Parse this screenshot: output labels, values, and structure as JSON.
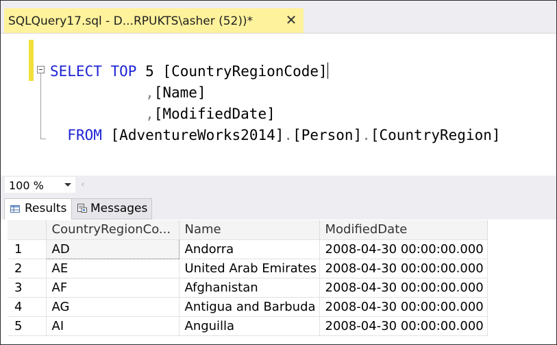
{
  "tab": {
    "title": "SQLQuery17.sql - D...RPUKTS\\asher (52))*",
    "close_glyph": "✕"
  },
  "editor": {
    "line1": {
      "kw1": "SELECT",
      "kw2": "TOP",
      "num": "5",
      "col": "[CountryRegionCode]"
    },
    "line2": {
      "comma": ",",
      "col": "[Name]"
    },
    "line3": {
      "comma": ",",
      "col": "[ModifiedDate]"
    },
    "line4": {
      "kw": "FROM",
      "db": "[AdventureWorks2014]",
      "dot1": ".",
      "schema": "[Person]",
      "dot2": ".",
      "table": "[CountryRegion]"
    }
  },
  "zoom": {
    "value": "100 %",
    "scroll_left_glyph": "‹"
  },
  "result_tabs": [
    {
      "label": "Results",
      "icon": "grid-icon",
      "active": true
    },
    {
      "label": "Messages",
      "icon": "messages-icon",
      "active": false
    }
  ],
  "grid": {
    "columns": [
      "",
      "CountryRegionCo...",
      "Name",
      "ModifiedDate"
    ],
    "rows": [
      [
        "1",
        "AD",
        "Andorra",
        "2008-04-30 00:00:00.000"
      ],
      [
        "2",
        "AE",
        "United Arab Emirates",
        "2008-04-30 00:00:00.000"
      ],
      [
        "3",
        "AF",
        "Afghanistan",
        "2008-04-30 00:00:00.000"
      ],
      [
        "4",
        "AG",
        "Antigua and Barbuda",
        "2008-04-30 00:00:00.000"
      ],
      [
        "5",
        "AI",
        "Anguilla",
        "2008-04-30 00:00:00.000"
      ]
    ]
  },
  "colors": {
    "tab_active": "#fff29d",
    "keyword": "#1c23d4",
    "operator": "#808080",
    "change_bar": "#f2df3a"
  }
}
